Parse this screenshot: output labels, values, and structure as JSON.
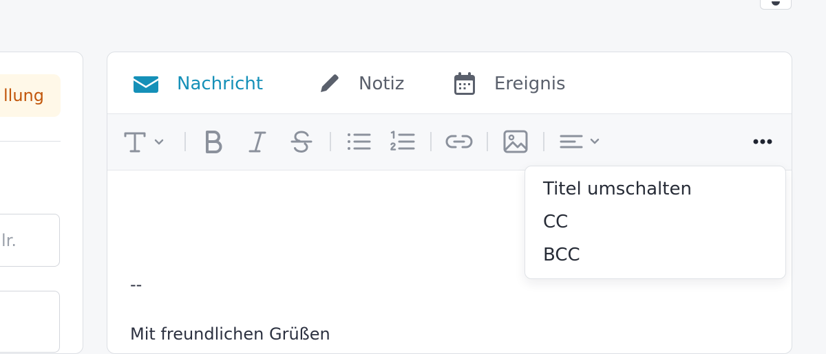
{
  "left_panel": {
    "status_label": "llung",
    "input_placeholder": "lr."
  },
  "tabs": [
    {
      "label": "Nachricht",
      "icon": "envelope-icon",
      "active": true
    },
    {
      "label": "Notiz",
      "icon": "pencil-icon",
      "active": false
    },
    {
      "label": "Ereignis",
      "icon": "calendar-icon",
      "active": false
    }
  ],
  "toolbar": {
    "buttons": [
      "text-style",
      "bold",
      "italic",
      "strikethrough",
      "bullet-list",
      "numbered-list",
      "link",
      "image",
      "align",
      "more"
    ]
  },
  "editor": {
    "signature_separator": "--",
    "signature_greeting": "Mit freundlichen Grüßen"
  },
  "menu": {
    "items": [
      "Titel umschalten",
      "CC",
      "BCC"
    ]
  },
  "colors": {
    "accent": "#1590b8",
    "status_text": "#c2570c",
    "status_bg": "#fff8e8",
    "icon_gray": "#8b919c"
  }
}
